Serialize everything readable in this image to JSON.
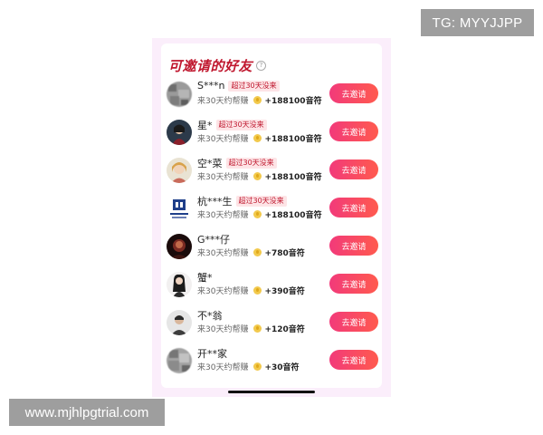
{
  "overlays": {
    "tg": "TG: MYYJJPP",
    "site": "www.mjhlpgtrial.com"
  },
  "section": {
    "title": "可邀请的好友",
    "help_icon": "question-circle-icon"
  },
  "friends": [
    {
      "name": "S***n",
      "tag": "超过30天没来",
      "desc": "来30天约帮赚",
      "reward": "+188100音符",
      "button": "去邀请"
    },
    {
      "name": "星*",
      "tag": "超过30天没来",
      "desc": "来30天约帮赚",
      "reward": "+188100音符",
      "button": "去邀请"
    },
    {
      "name": "空*菜",
      "tag": "超过30天没来",
      "desc": "来30天约帮赚",
      "reward": "+188100音符",
      "button": "去邀请"
    },
    {
      "name": "杭***生",
      "tag": "超过30天没来",
      "desc": "来30天约帮赚",
      "reward": "+188100音符",
      "button": "去邀请"
    },
    {
      "name": "G***仔",
      "tag": "",
      "desc": "来30天约帮赚",
      "reward": "+780音符",
      "button": "去邀请"
    },
    {
      "name": "蟹*",
      "tag": "",
      "desc": "来30天约帮赚",
      "reward": "+390音符",
      "button": "去邀请"
    },
    {
      "name": "不*翁",
      "tag": "",
      "desc": "来30天约帮赚",
      "reward": "+120音符",
      "button": "去邀请"
    },
    {
      "name": "开**家",
      "tag": "",
      "desc": "来30天约帮赚",
      "reward": "+30音符",
      "button": "去邀请"
    }
  ],
  "colors": {
    "accent": "#c0182f",
    "button_start": "#f23a7a",
    "button_end": "#ff5a4e",
    "panel_bg": "#fbeefb"
  }
}
